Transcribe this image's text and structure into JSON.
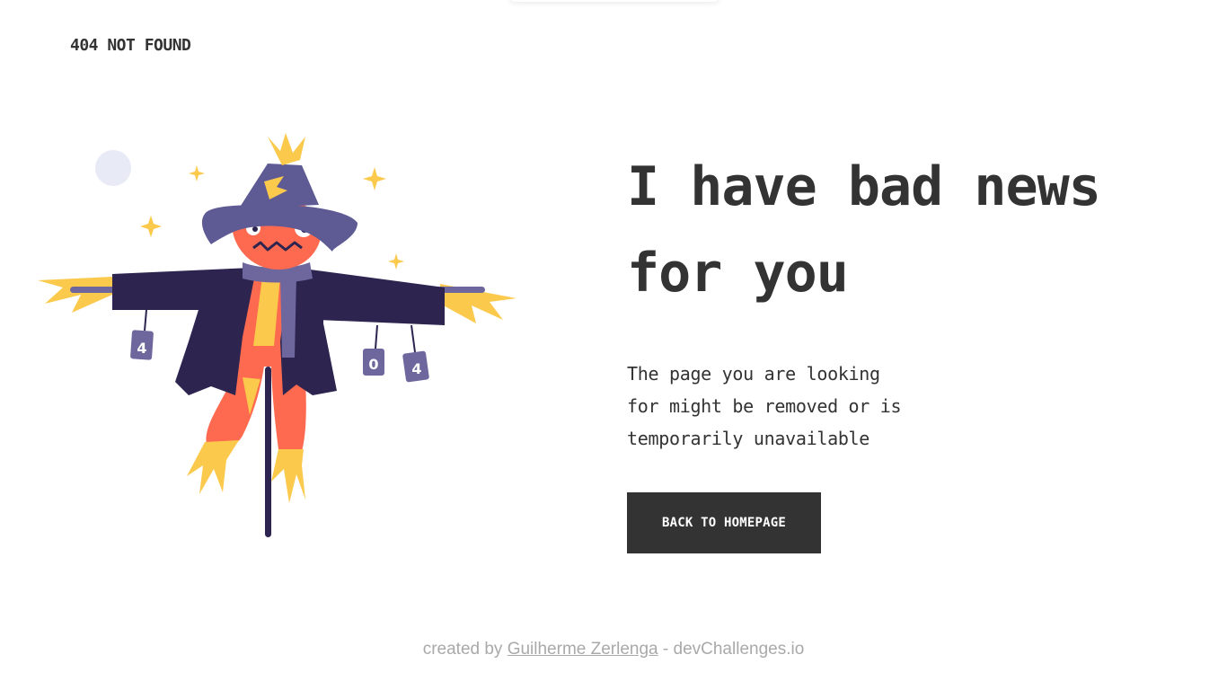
{
  "header": {
    "brand": "404 NOT FOUND"
  },
  "main": {
    "headline_line1": "I have bad news",
    "headline_line2": "for you",
    "description_line1": "The page you are looking",
    "description_line2": "for might be removed or is",
    "description_line3": "temporarily unavailable",
    "button_label": "BACK TO HOMEPAGE"
  },
  "illustration": {
    "can_labels": [
      "4",
      "0",
      "4"
    ],
    "icon": "scarecrow-illustration"
  },
  "footer": {
    "prefix": "created by ",
    "author": "Guilherme Zerlenga",
    "suffix": " - devChallenges.io"
  },
  "colors": {
    "text": "#333333",
    "button_bg": "#333333",
    "button_text": "#ffffff",
    "footer_text": "#a9a9a9",
    "hat": "#5e5a94",
    "coat": "#2d2550",
    "face": "#fd6a4f",
    "straw": "#fbc94c"
  }
}
